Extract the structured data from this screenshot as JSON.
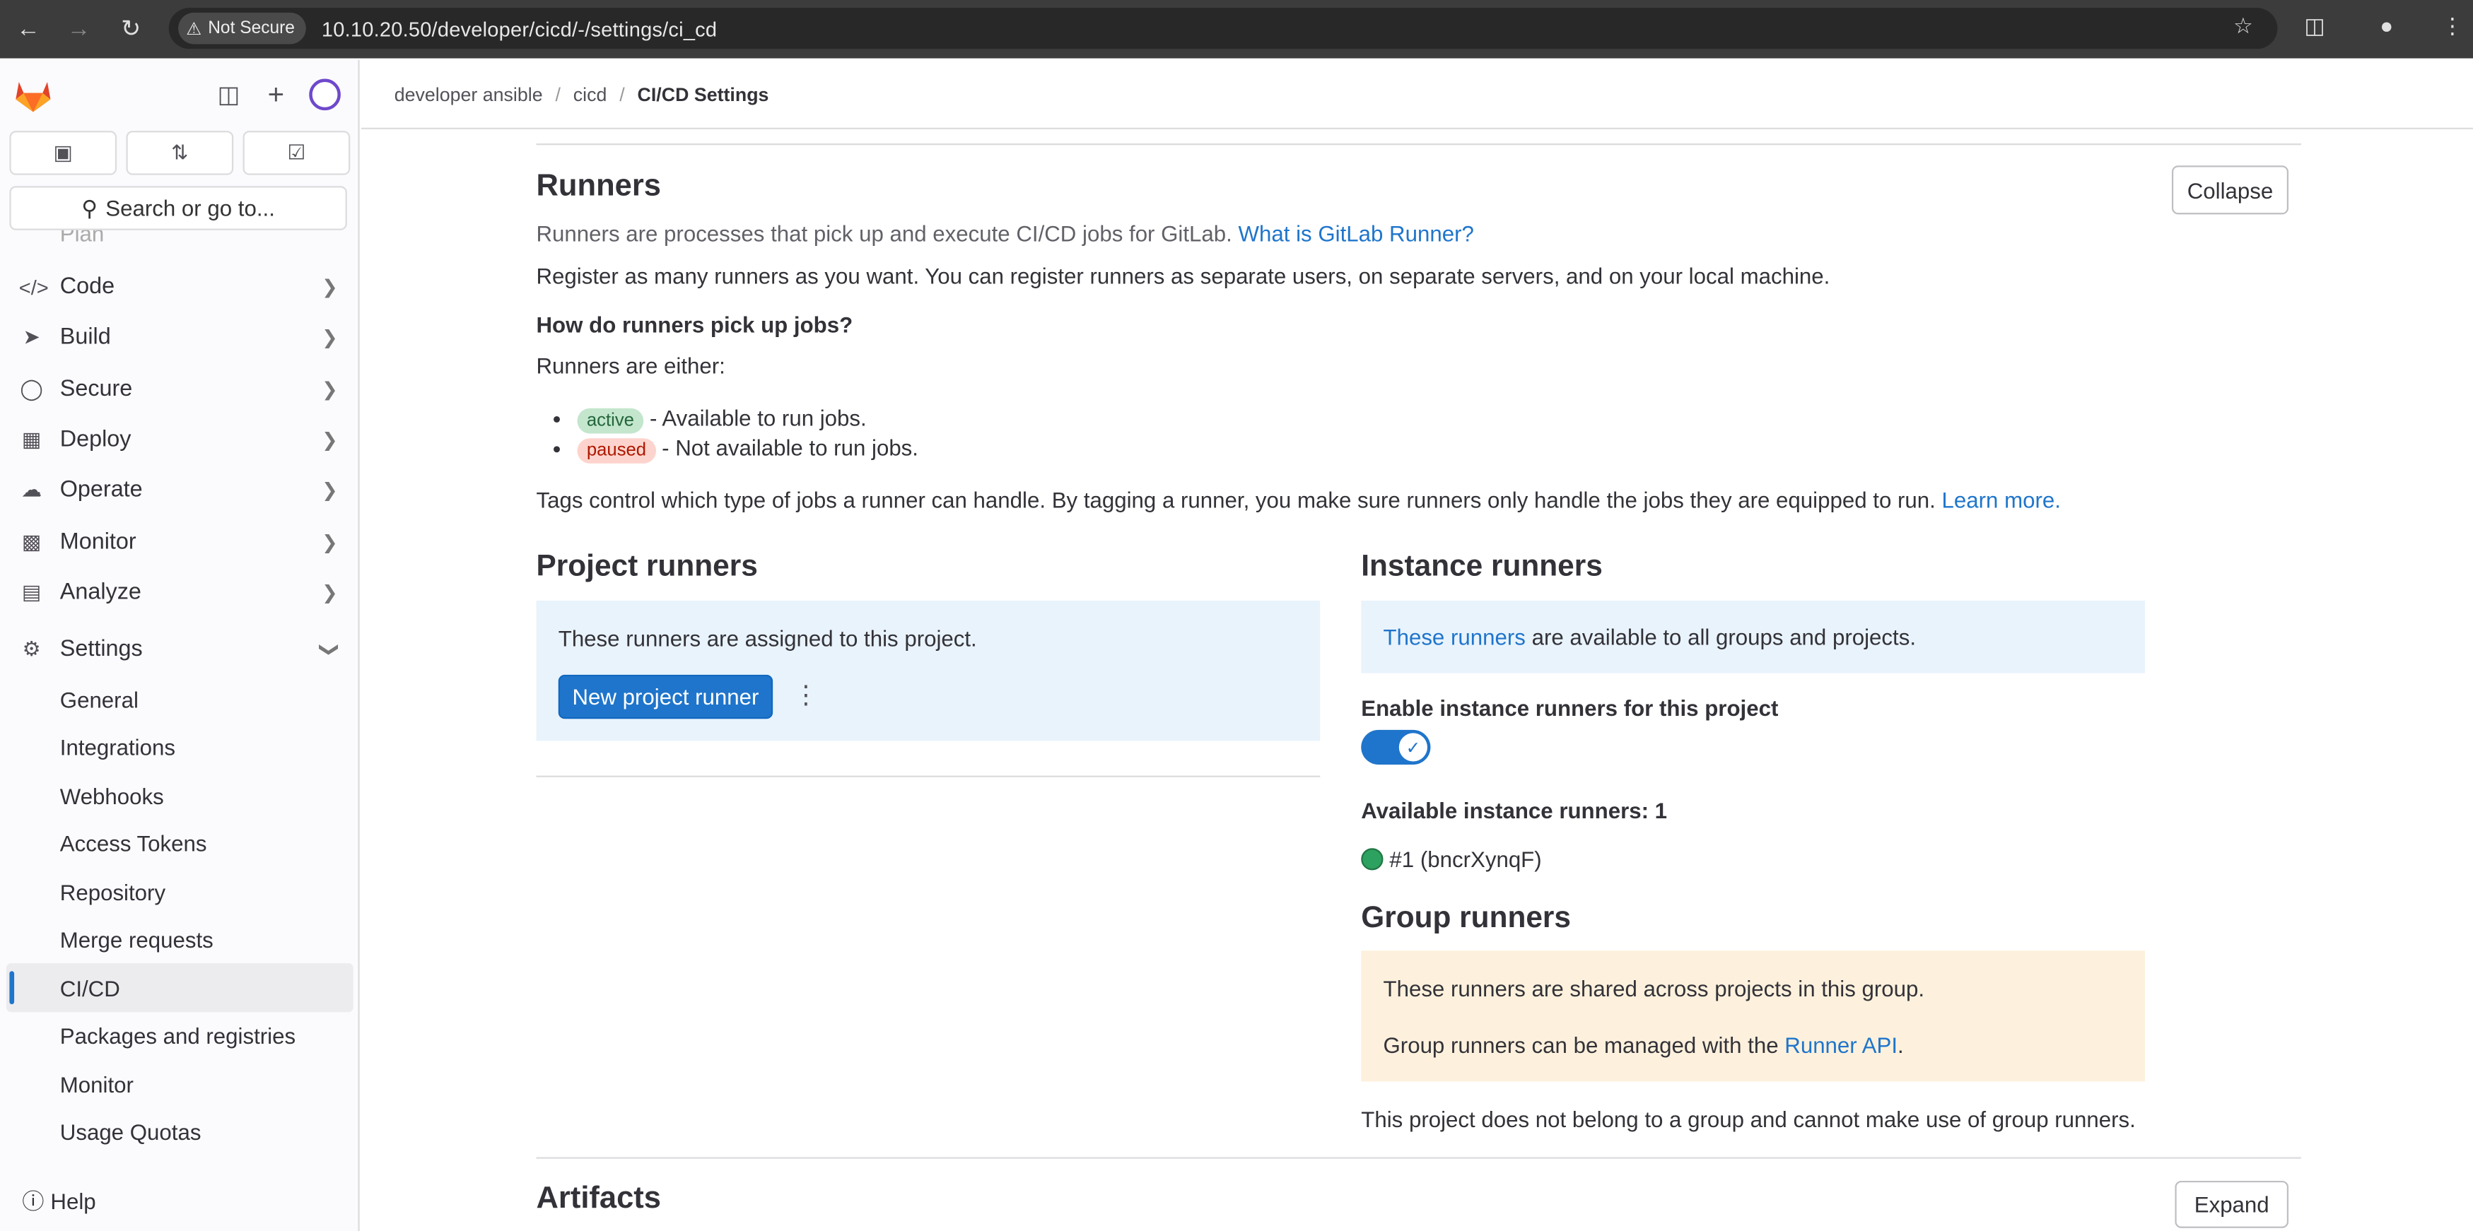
{
  "browser": {
    "security_label": "Not Secure",
    "url": "10.10.20.50/developer/cicd/-/settings/ci_cd"
  },
  "sidebar": {
    "search_label": "Search or go to...",
    "clipped_item": "Plan",
    "nav_items": [
      {
        "label": "Code",
        "icon": "code-icon"
      },
      {
        "label": "Build",
        "icon": "rocket-icon"
      },
      {
        "label": "Secure",
        "icon": "shield-icon"
      },
      {
        "label": "Deploy",
        "icon": "deploy-icon"
      },
      {
        "label": "Operate",
        "icon": "cloud-icon"
      },
      {
        "label": "Monitor",
        "icon": "monitor-icon"
      },
      {
        "label": "Analyze",
        "icon": "chart-icon"
      },
      {
        "label": "Settings",
        "icon": "gear-icon"
      }
    ],
    "settings_subitems": [
      "General",
      "Integrations",
      "Webhooks",
      "Access Tokens",
      "Repository",
      "Merge requests",
      "CI/CD",
      "Packages and registries",
      "Monitor",
      "Usage Quotas"
    ],
    "active_subitem": "CI/CD",
    "help_label": "Help"
  },
  "breadcrumb": {
    "items": [
      "developer ansible",
      "cicd"
    ],
    "current": "CI/CD Settings"
  },
  "runners": {
    "title": "Runners",
    "collapse_label": "Collapse",
    "intro_text": "Runners are processes that pick up and execute CI/CD jobs for GitLab.",
    "intro_link": "What is GitLab Runner?",
    "register_text": "Register as many runners as you want. You can register runners as separate users, on separate servers, and on your local machine.",
    "how_heading": "How do runners pick up jobs?",
    "either_text": "Runners are either:",
    "states": [
      {
        "badge": "active",
        "text": "- Available to run jobs."
      },
      {
        "badge": "paused",
        "text": "- Not available to run jobs."
      }
    ],
    "tags_text": "Tags control which type of jobs a runner can handle. By tagging a runner, you make sure runners only handle the jobs they are equipped to run.",
    "tags_link": "Learn more."
  },
  "project_runners": {
    "title": "Project runners",
    "assigned_text": "These runners are assigned to this project.",
    "new_button": "New project runner"
  },
  "instance_runners": {
    "title": "Instance runners",
    "link_text": "These runners",
    "text": "are available to all groups and projects.",
    "enable_label": "Enable instance runners for this project",
    "enabled": true,
    "available_label": "Available instance runners: 1",
    "runner_item": "#1 (bncrXynqF)"
  },
  "group_runners": {
    "title": "Group runners",
    "shared_text": "These runners are shared across projects in this group.",
    "managed_text_pre": "Group runners can be managed with the",
    "managed_link": "Runner API",
    "managed_text_post": ".",
    "note": "This project does not belong to a group and cannot make use of group runners."
  },
  "artifacts": {
    "title": "Artifacts",
    "expand_label": "Expand"
  },
  "colors": {
    "brand_blue": "#1f75cb",
    "active_badge_bg": "#c3e6cd",
    "paused_badge_bg": "#fdd4cd",
    "status_green": "#2da160"
  }
}
